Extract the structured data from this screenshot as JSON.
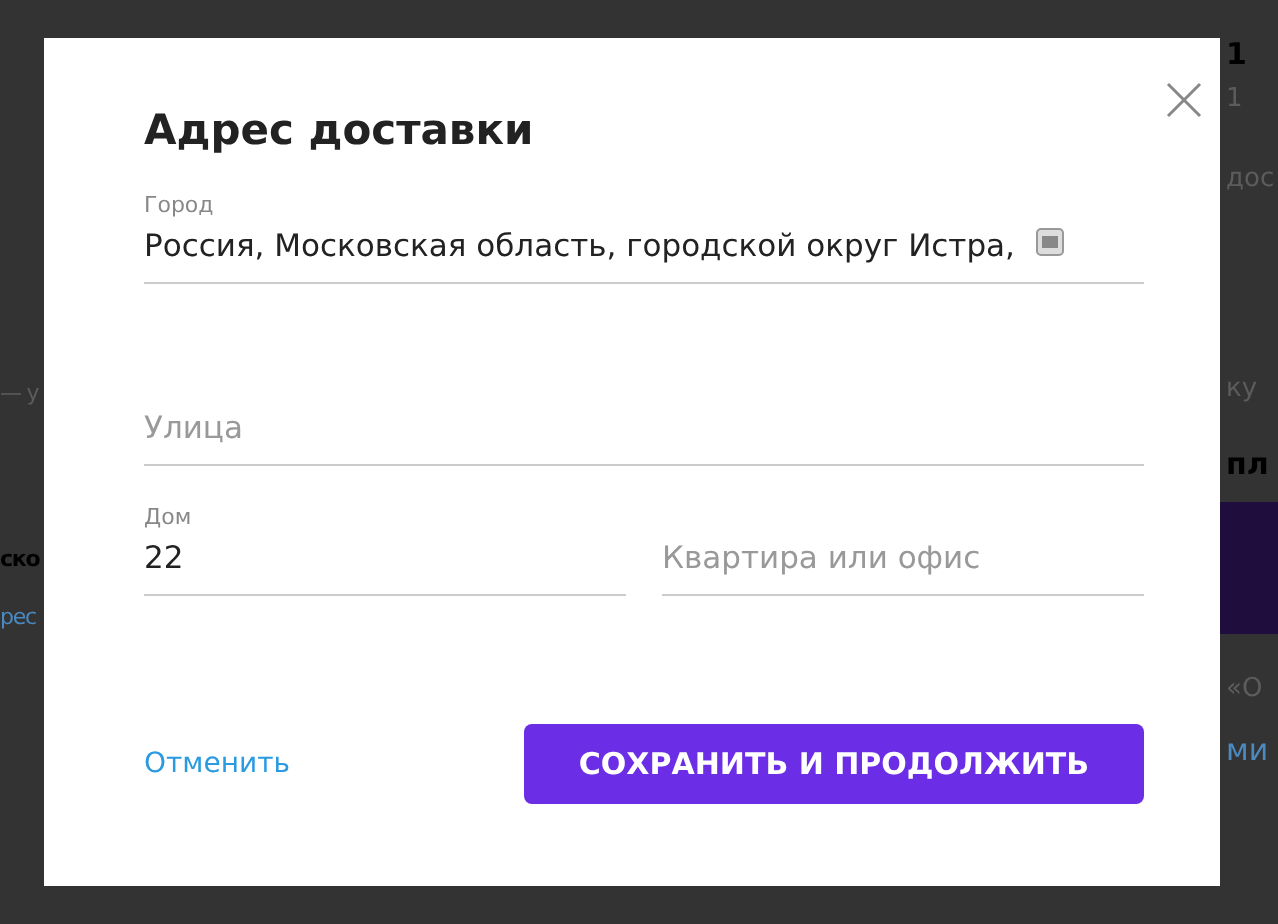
{
  "background": {
    "left": [
      {
        "text": "— у",
        "kind": "plain"
      },
      {
        "text": "ско",
        "kind": "heading"
      },
      {
        "text": "рес",
        "kind": "link"
      }
    ],
    "right": [
      {
        "text": "1",
        "kind": "heading"
      },
      {
        "text": "1",
        "kind": "plain"
      },
      {
        "text": "дос",
        "kind": "plain"
      },
      {
        "text": "ку",
        "kind": "plain"
      },
      {
        "text": "пл",
        "kind": "heading"
      },
      {
        "text": "«О",
        "kind": "plain"
      },
      {
        "text": "ми",
        "kind": "link"
      }
    ]
  },
  "dialog": {
    "title": "Адрес доставки",
    "fields": [
      {
        "label": "Город",
        "value": "Россия, Московская область, городской округ Истра,",
        "kind": "full"
      },
      {
        "placeholder": "Улица",
        "kind": "full"
      },
      {
        "label": "Дом",
        "value": "22",
        "kind": "half"
      },
      {
        "placeholder": "Квартира или офис",
        "kind": "half"
      }
    ],
    "cancel": "Отменить",
    "submit": "СОХРАНИТЬ И ПРОДОЛЖИТЬ"
  }
}
